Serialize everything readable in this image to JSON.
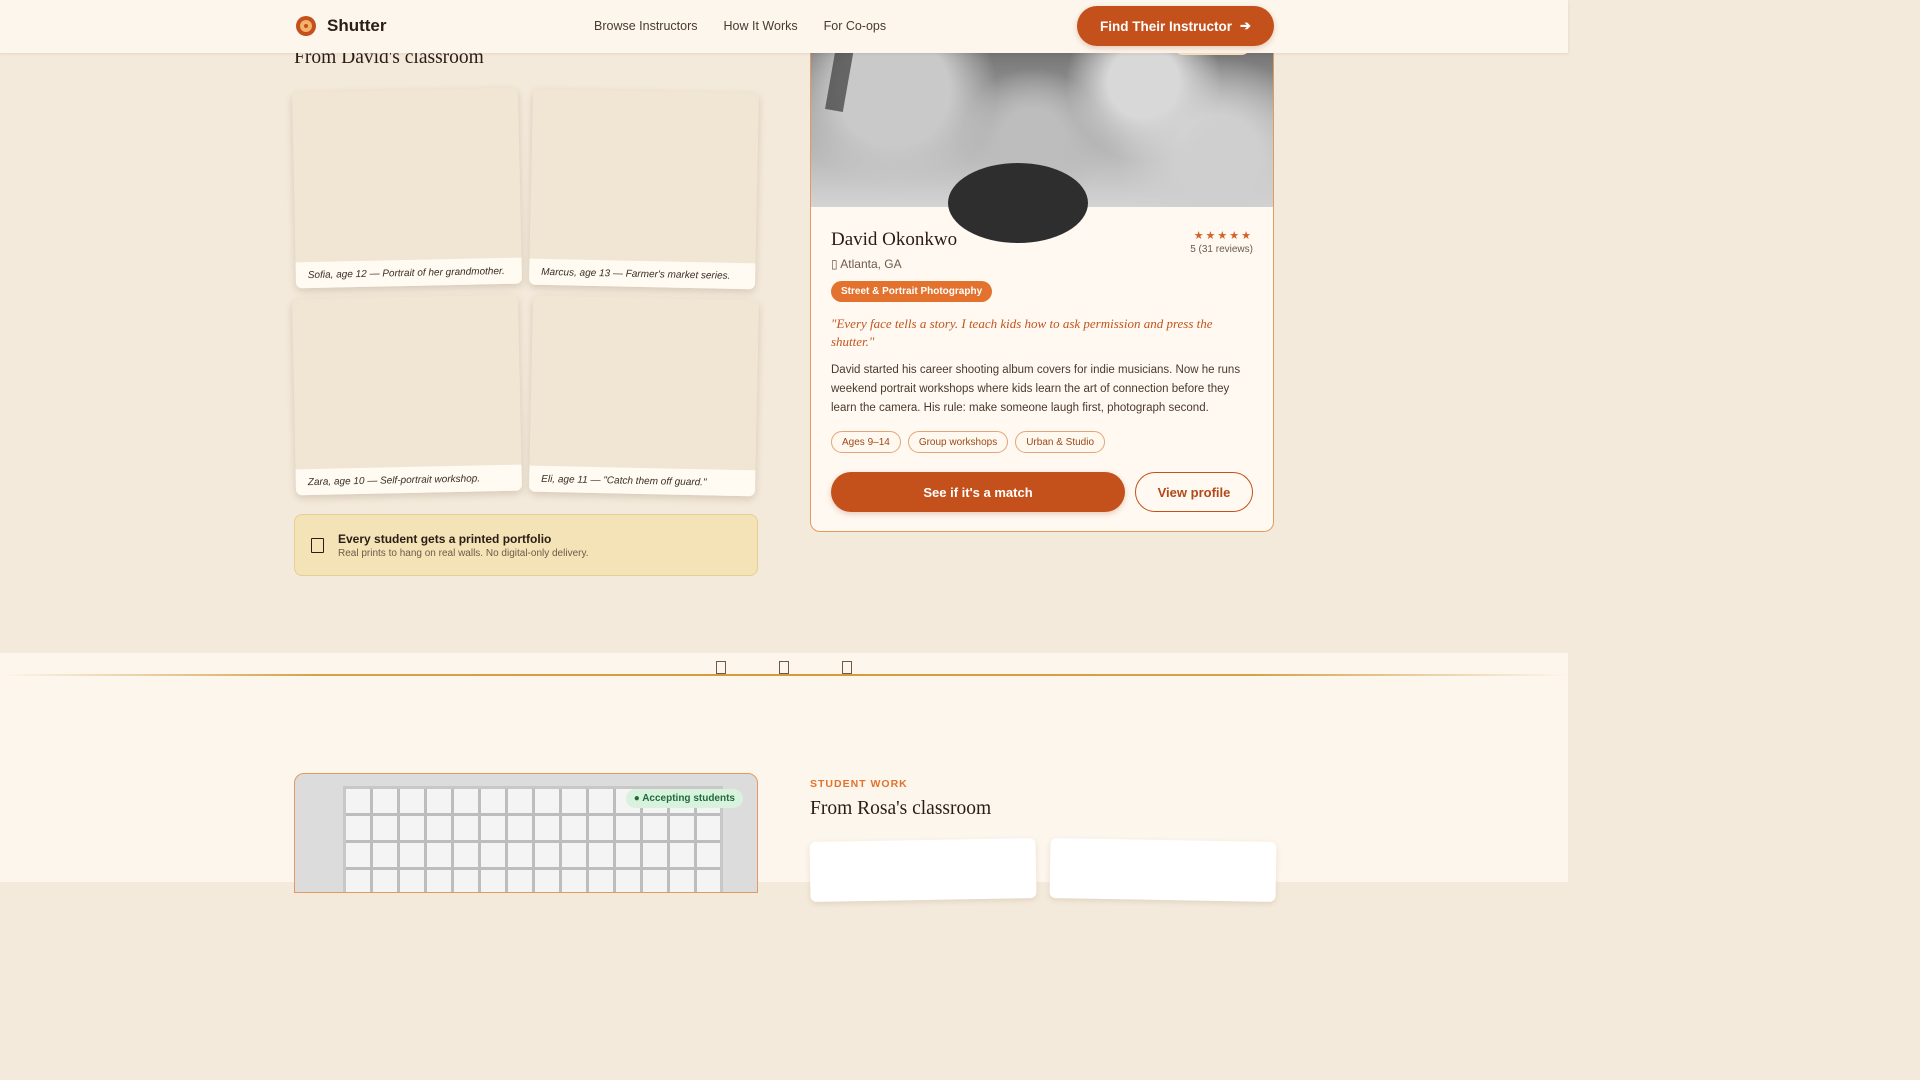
{
  "nav": {
    "brand": "Shutter",
    "links": [
      "Browse Instructors",
      "How It Works",
      "For Co-ops"
    ],
    "cta": "Find Their Instructor",
    "cta_icon": "arrow-right-icon"
  },
  "gallery1": {
    "title": "From David's classroom",
    "prints": [
      {
        "caption": "Sofia, age 12 — Portrait of her grandmother."
      },
      {
        "caption": "Marcus, age 13 — Farmer's market series."
      },
      {
        "caption": "Zara, age 10 — Self-portrait workshop."
      },
      {
        "caption": "Eli, age 11 — \"Catch them off guard.\""
      }
    ],
    "banner": {
      "title": "Every student gets a printed portfolio",
      "subtitle": "Real prints to hang on real walls. No digital-only delivery."
    }
  },
  "instructor": {
    "name": "David Okonkwo",
    "location": "Atlanta, GA",
    "stars": "★★★★★",
    "rating": "5 (31 reviews)",
    "specialty": "Street & Portrait Photography",
    "quote": "\"Every face tells a story. I teach kids how to ask permission and press the shutter.\"",
    "bio": "David started his career shooting album covers for indie musicians. Now he runs weekend portrait workshops where kids learn the art of connection before they learn the camera. His rule: make someone laugh first, photograph second.",
    "tags": [
      "Ages 9–14",
      "Group workshops",
      "Urban & Studio"
    ],
    "primary_cta": "See if it's a match",
    "secondary_cta": "View profile"
  },
  "section2": {
    "status": "● Accepting students",
    "eyebrow": "STUDENT WORK",
    "title": "From Rosa's classroom"
  },
  "colors": {
    "accent": "#c4501b",
    "background": "#f4eadb",
    "card": "#fff9f1"
  }
}
